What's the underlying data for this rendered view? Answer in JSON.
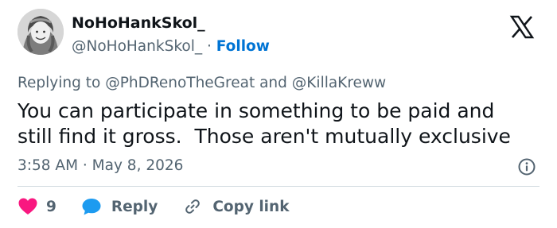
{
  "author": {
    "display_name": "NoHoHankSkol_",
    "handle": "@NoHoHankSkol_",
    "separator": "·",
    "follow_label": "Follow",
    "avatar_icon": "avatar-portrait"
  },
  "platform": {
    "logo_icon": "x-logo-icon"
  },
  "reply_context": {
    "prefix": "Replying to",
    "mention_1": "@PhDRenoTheGreat",
    "conjunction": "and",
    "mention_2": "@KillaKreww"
  },
  "tweet": {
    "text_lines": [
      "You can participate in something to be paid and",
      "still find it gross.  Those aren't mutually exclusive"
    ],
    "timestamp": "3:58 AM · May 8, 2026"
  },
  "actions": {
    "like_count": "9",
    "reply_label": "Reply",
    "copy_link_label": "Copy link"
  },
  "colors": {
    "text": "#0f1419",
    "muted": "#536471",
    "follow": "#0074d4",
    "like": "#f91880",
    "reply_icon": "#1d9bf0",
    "divider": "#cfd9de"
  }
}
